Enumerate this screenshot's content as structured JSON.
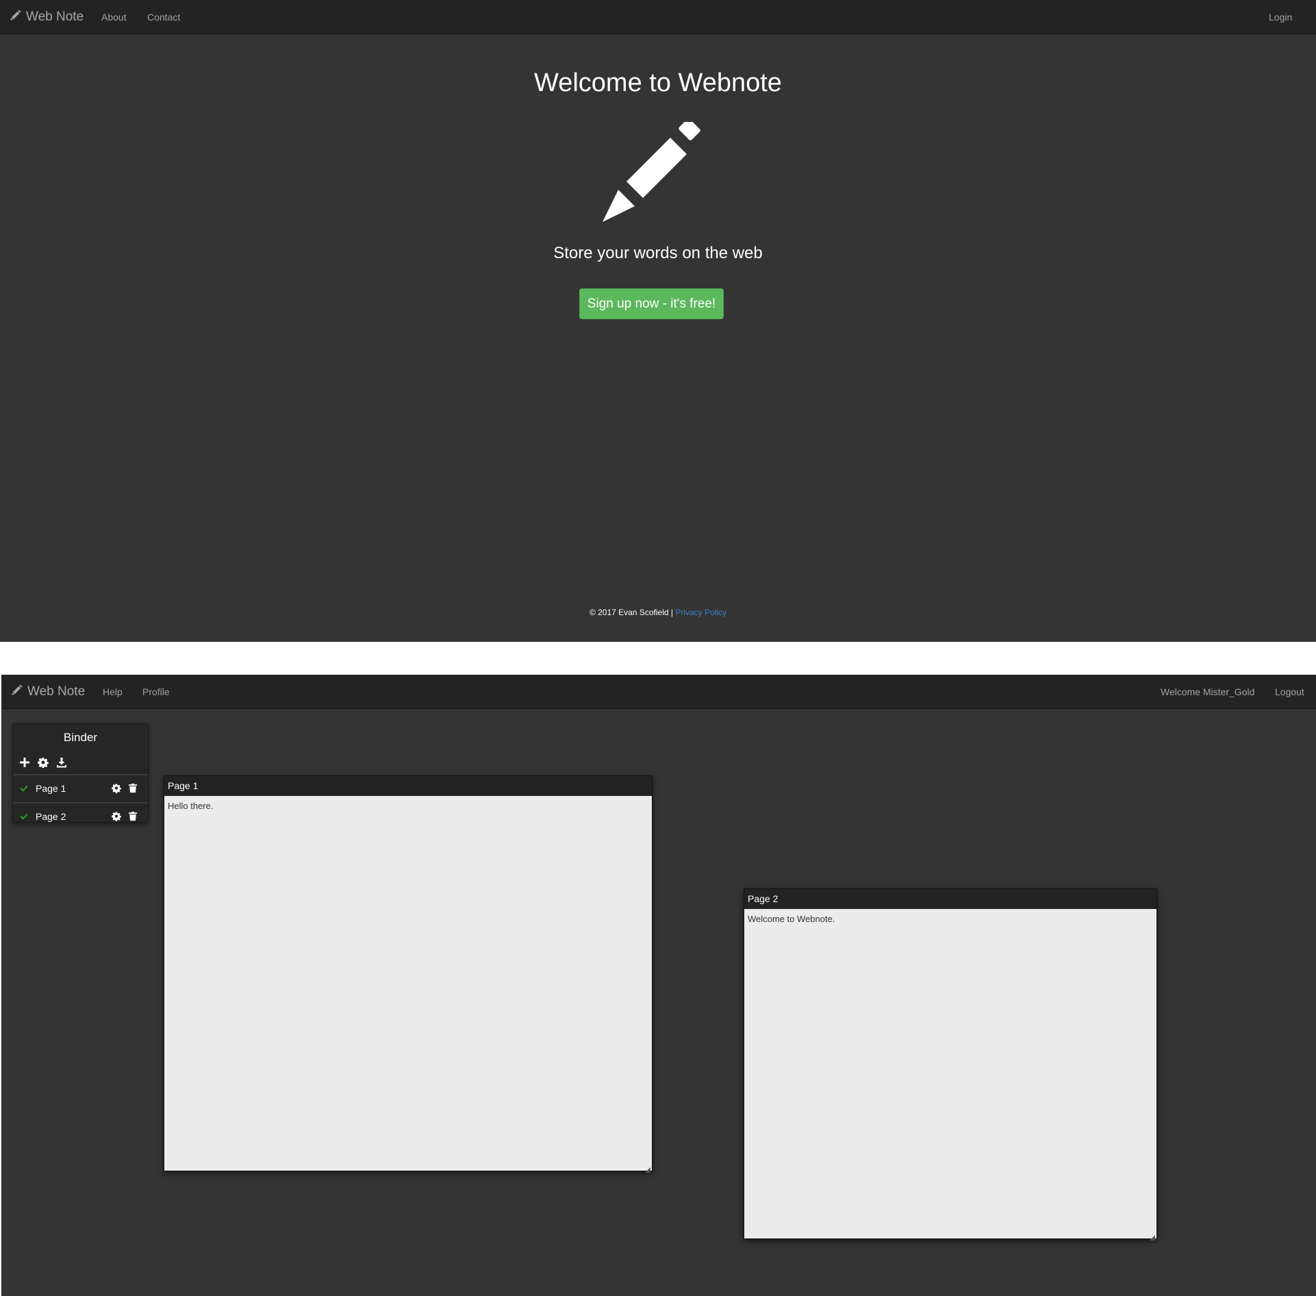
{
  "landing": {
    "nav": {
      "brand": "Web Note",
      "links": [
        "About",
        "Contact"
      ],
      "login": "Login"
    },
    "hero": {
      "title": "Welcome to Webnote",
      "icon": "pencil-icon",
      "tagline": "Store your words on the web",
      "cta": "Sign up now - it's free!"
    },
    "footer": {
      "copyright": "© 2017 Evan Scofield |",
      "privacy_link": "Privacy Policy"
    }
  },
  "dashboard": {
    "nav": {
      "brand": "Web Note",
      "links": [
        "Help",
        "Profile"
      ],
      "welcome": "Welcome Mister_Gold",
      "logout": "Logout"
    },
    "binder": {
      "title": "Binder",
      "tools": [
        "plus-icon",
        "gear-icon",
        "download-icon"
      ],
      "pages": [
        {
          "label": "Page 1",
          "status": "check-icon"
        },
        {
          "label": "Page 2",
          "status": "check-icon"
        }
      ]
    },
    "windows": [
      {
        "title": "Page 1",
        "content": "Hello there."
      },
      {
        "title": "Page 2",
        "content": "Welcome to Webnote."
      }
    ]
  },
  "colors": {
    "background": "#343434",
    "navbar": "#232323",
    "accent_green": "#5cb85c",
    "check_green": "#2e8b2e",
    "link_blue": "#3f80c4",
    "note_paper": "#ececec"
  }
}
